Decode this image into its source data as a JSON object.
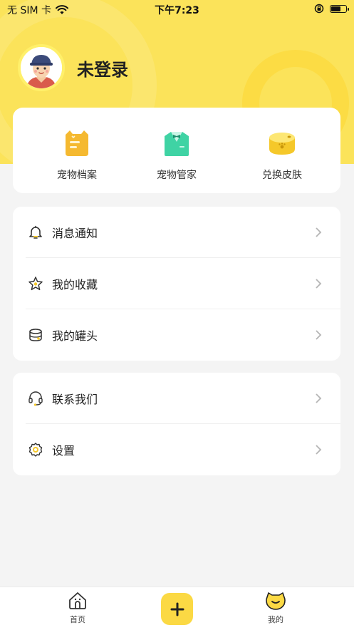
{
  "status_bar": {
    "carrier": "无 SIM 卡",
    "time": "下午7:23",
    "wifi_icon": "wifi-icon",
    "lock_icon": "orientation-lock-icon",
    "battery_icon": "battery-icon",
    "battery_level": 0.75
  },
  "profile": {
    "avatar_icon": "user-avatar-icon",
    "login_status": "未登录"
  },
  "features": [
    {
      "label": "宠物档案",
      "icon": "pet-file-icon"
    },
    {
      "label": "宠物管家",
      "icon": "pet-butler-icon"
    },
    {
      "label": "兑换皮肤",
      "icon": "skin-can-icon"
    }
  ],
  "menu_group1": [
    {
      "label": "消息通知",
      "icon": "bell-icon"
    },
    {
      "label": "我的收藏",
      "icon": "star-icon"
    },
    {
      "label": "我的罐头",
      "icon": "can-icon"
    }
  ],
  "menu_group2": [
    {
      "label": "联系我们",
      "icon": "headset-icon"
    },
    {
      "label": "设置",
      "icon": "settings-icon"
    }
  ],
  "tabbar": {
    "home": {
      "label": "首页",
      "icon": "home-icon"
    },
    "add": {
      "icon": "plus-icon"
    },
    "mine": {
      "label": "我的",
      "icon": "pet-face-icon"
    }
  },
  "colors": {
    "accent": "#fbe35a",
    "button": "#fbd944",
    "background": "#f4f4f4",
    "card": "#ffffff"
  }
}
